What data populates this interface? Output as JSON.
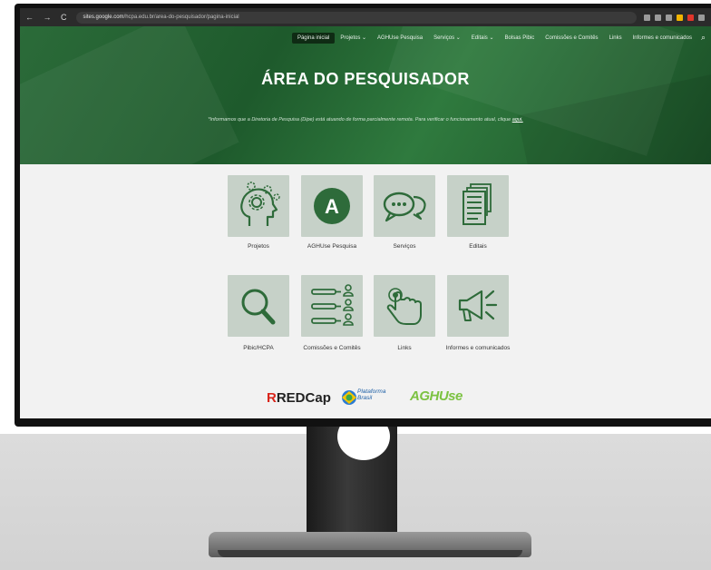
{
  "browser": {
    "url_domain": "sites.google.com",
    "url_path": "/hcpa.edu.br/area-do-pesquisador/pagina-inicial"
  },
  "menu": {
    "items": [
      "Página inicial",
      "Projetos",
      "AGHUse Pesquisa",
      "Serviços",
      "Editais",
      "Bolsas Pibic",
      "Comissões e Comitês",
      "Links",
      "Informes e comunicados"
    ],
    "active": "Página inicial"
  },
  "hero": {
    "title": "ÁREA DO PESQUISADOR",
    "notice": "*Informamos que a Diretoria de Pesquisa (Dipe) está atuando de forma parcialmente remota. Para verificar o funcionamento atual, clique",
    "notice_link": "aqui."
  },
  "cards": [
    {
      "label": "Projetos",
      "icon": "head-gears-icon"
    },
    {
      "label": "AGHUse Pesquisa",
      "icon": "letter-a-icon"
    },
    {
      "label": "Serviços",
      "icon": "chat-bubbles-icon"
    },
    {
      "label": "Editais",
      "icon": "documents-icon"
    },
    {
      "label": "Pibic/HCPA",
      "icon": "magnifier-icon"
    },
    {
      "label": "Comissões e Comitês",
      "icon": "committee-list-icon"
    },
    {
      "label": "Links",
      "icon": "pointer-hand-icon"
    },
    {
      "label": "Informes e comunicados",
      "icon": "megaphone-icon"
    }
  ],
  "logos": {
    "redcap": "REDCap",
    "plataforma_line1": "Plataforma",
    "plataforma_line2": "Brasil",
    "aghuse": "AGHUse"
  },
  "colors": {
    "hero_green": "#1e5a2c",
    "card_bg": "#c6d1c8",
    "icon_green": "#2e6b3a"
  }
}
